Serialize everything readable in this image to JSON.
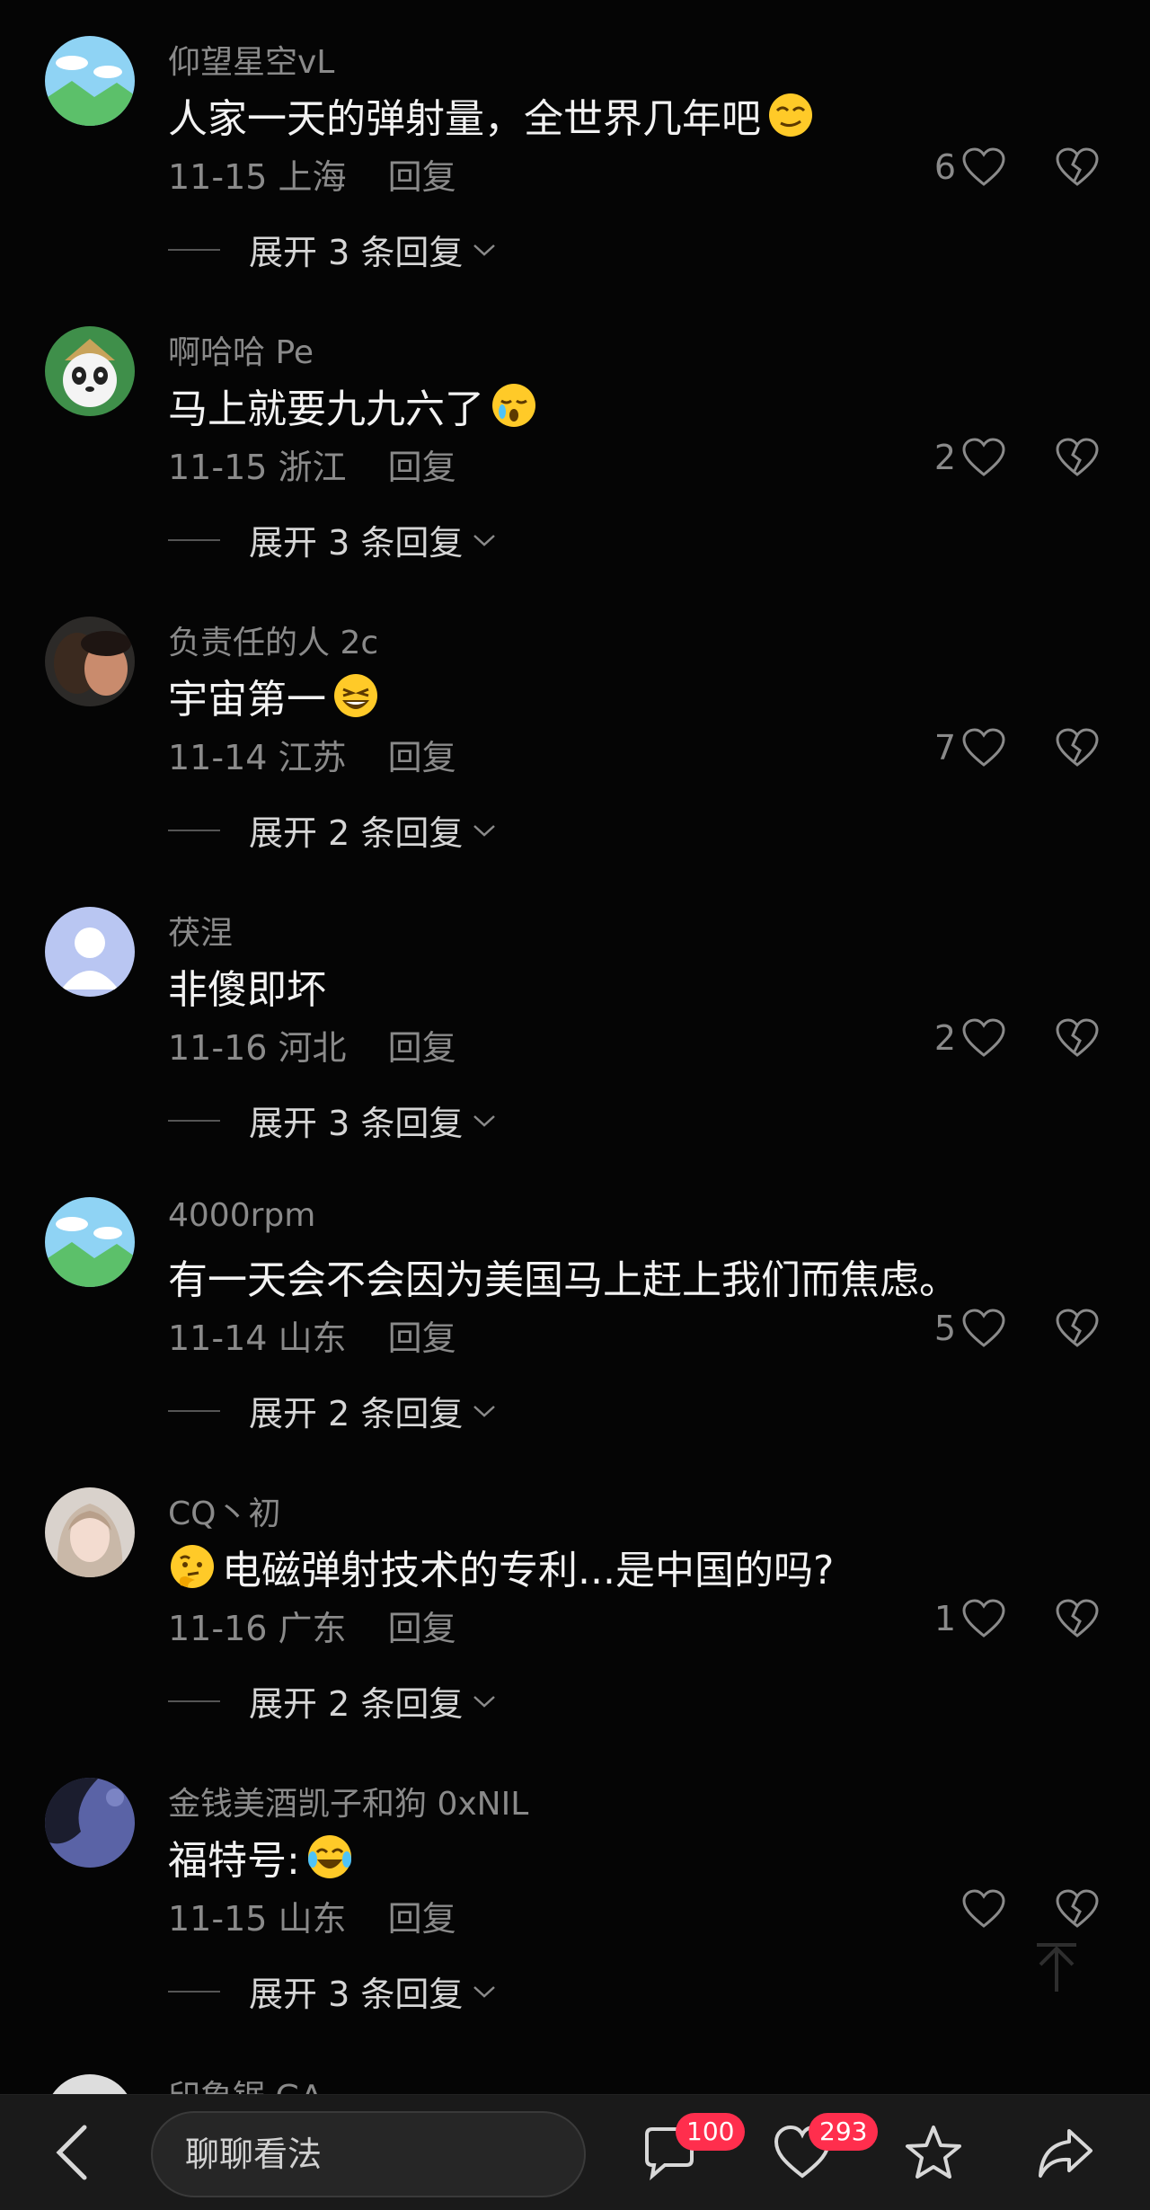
{
  "comments": [
    {
      "username": "仰望星空vL",
      "text": "人家一天的弹射量，全世界几年吧",
      "emoji": "smug-face-emoji",
      "date": "11-15",
      "location": "上海",
      "reply": "回复",
      "likes": "6",
      "expand": "展开 3 条回复"
    },
    {
      "username": "啊哈哈 Pe",
      "text": "马上就要九九六了",
      "emoji": "crying-face-emoji",
      "date": "11-15",
      "location": "浙江",
      "reply": "回复",
      "likes": "2",
      "expand": "展开 3 条回复"
    },
    {
      "username": "负责任的人 2c",
      "text": "宇宙第一",
      "emoji": "grinning-face-emoji",
      "date": "11-14",
      "location": "江苏",
      "reply": "回复",
      "likes": "7",
      "expand": "展开 2 条回复"
    },
    {
      "username": "茯涅",
      "text": "非傻即坏",
      "emoji": "",
      "date": "11-16",
      "location": "河北",
      "reply": "回复",
      "likes": "2",
      "expand": "展开 3 条回复"
    },
    {
      "username": "4000rpm",
      "text": "有一天会不会因为美国马上赶上我们而焦虑。",
      "emoji": "",
      "date": "11-14",
      "location": "山东",
      "reply": "回复",
      "likes": "5",
      "expand": "展开 2 条回复"
    },
    {
      "username": "CQ丶初",
      "text": "电磁弹射技术的专利...是中国的吗?",
      "emoji": "thinking-face-emoji",
      "date": "11-16",
      "location": "广东",
      "reply": "回复",
      "likes": "1",
      "expand": "展开 2 条回复"
    },
    {
      "username": "金钱美酒凯子和狗 0xNIL",
      "text": "福特号:",
      "emoji": "tears-of-joy-emoji",
      "date": "11-15",
      "location": "山东",
      "reply": "回复",
      "likes": "",
      "expand": "展开 3 条回复"
    }
  ],
  "partial_username": "印象锯 GA",
  "bottom_bar": {
    "input_placeholder": "聊聊看法",
    "comment_count": "100",
    "like_count": "293"
  },
  "colors": {
    "background": "#050505",
    "badge": "#ff2e4d",
    "muted_text": "#8a8a8a"
  }
}
